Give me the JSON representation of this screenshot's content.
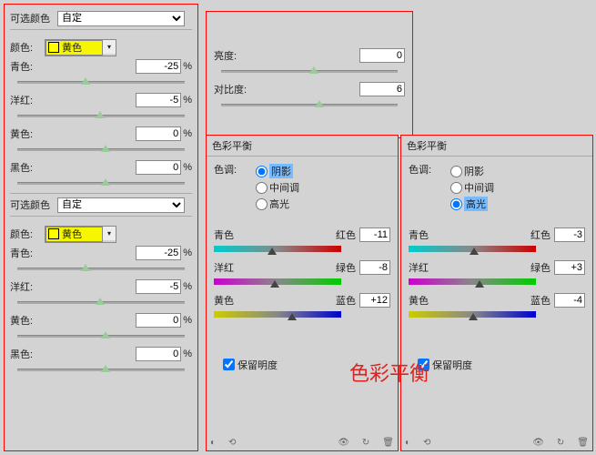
{
  "sc1": {
    "header_label": "可选颜色",
    "header_value": "自定",
    "color_label": "颜色:",
    "color_value": "黄色",
    "cyan": {
      "label": "青色:",
      "val": "-25",
      "pct": "%"
    },
    "magenta": {
      "label": "洋红:",
      "val": "-5",
      "pct": "%"
    },
    "yellow": {
      "label": "黄色:",
      "val": "0",
      "pct": "%"
    },
    "black": {
      "label": "黑色:",
      "val": "0",
      "pct": "%"
    }
  },
  "sc2": {
    "header_label": "可选颜色",
    "header_value": "自定",
    "color_label": "颜色:",
    "color_value": "黄色",
    "cyan": {
      "label": "青色:",
      "val": "-25",
      "pct": "%"
    },
    "magenta": {
      "label": "洋红:",
      "val": "-5",
      "pct": "%"
    },
    "yellow": {
      "label": "黄色:",
      "val": "0",
      "pct": "%"
    },
    "black": {
      "label": "黑色:",
      "val": "0",
      "pct": "%"
    }
  },
  "bc": {
    "brightness_label": "亮度:",
    "brightness_val": "0",
    "contrast_label": "对比度:",
    "contrast_val": "6"
  },
  "cb1": {
    "title": "色彩平衡",
    "tone_label": "色调:",
    "tones": {
      "shadow": "阴影",
      "mid": "中间调",
      "hi": "高光"
    },
    "sel": "shadow",
    "s1": {
      "l": "青色",
      "r": "红色",
      "v": "-11"
    },
    "s2": {
      "l": "洋红",
      "r": "绿色",
      "v": "-8"
    },
    "s3": {
      "l": "黄色",
      "r": "蓝色",
      "v": "+12"
    },
    "preserve": "保留明度"
  },
  "cb2": {
    "title": "色彩平衡",
    "tone_label": "色调:",
    "tones": {
      "shadow": "阴影",
      "mid": "中间调",
      "hi": "高光"
    },
    "sel": "hi",
    "s1": {
      "l": "青色",
      "r": "红色",
      "v": "-3"
    },
    "s2": {
      "l": "洋红",
      "r": "绿色",
      "v": "+3"
    },
    "s3": {
      "l": "黄色",
      "r": "蓝色",
      "v": "-4"
    },
    "preserve": "保留明度"
  },
  "overlay": "色彩平衡"
}
